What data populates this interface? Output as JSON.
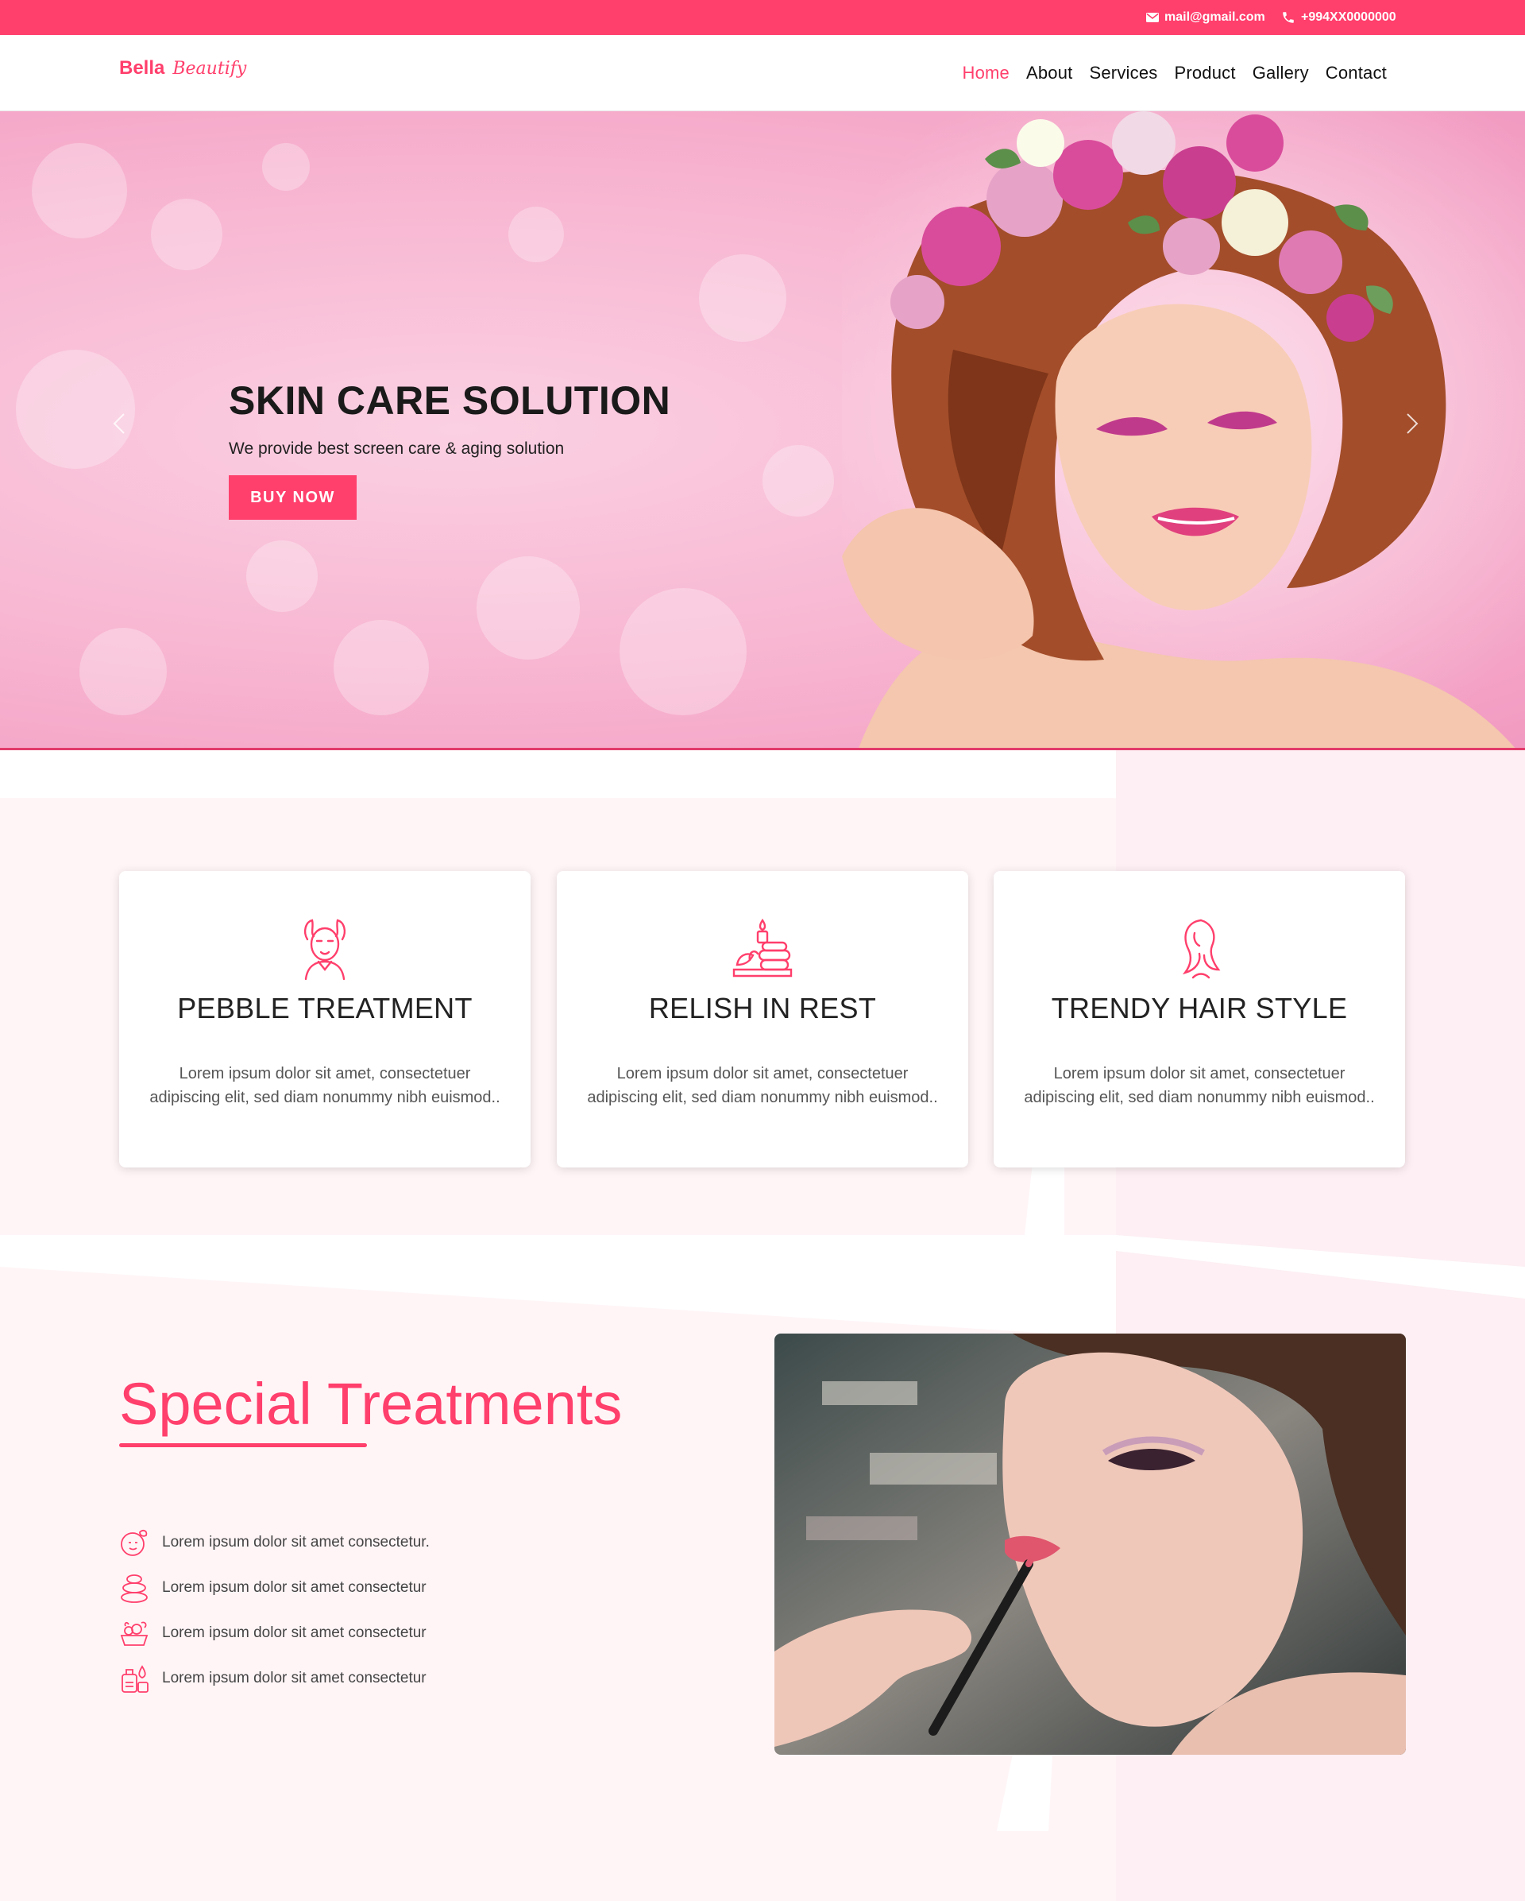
{
  "topbar": {
    "email": "mail@gmail.com",
    "phone": "+994XX0000000"
  },
  "nav": {
    "logo_bold": "Bella",
    "logo_script": "Beautify",
    "items": [
      {
        "label": "Home",
        "active": true
      },
      {
        "label": "About"
      },
      {
        "label": "Services"
      },
      {
        "label": "Product"
      },
      {
        "label": "Gallery"
      },
      {
        "label": "Contact"
      }
    ]
  },
  "hero": {
    "title": "SKIN CARE SOLUTION",
    "subtitle": "We provide best screen care & aging solution",
    "button": "BUY NOW"
  },
  "cards": [
    {
      "icon": "face-mask-icon",
      "title": "PEBBLE TREATMENT",
      "text": "Lorem ipsum dolor sit amet, consectetuer adipiscing elit, sed diam nonummy nibh euismod.."
    },
    {
      "icon": "spa-stones-candle-icon",
      "title": "RELISH IN REST",
      "text": "Lorem ipsum dolor sit amet, consectetuer adipiscing elit, sed diam nonummy nibh euismod.."
    },
    {
      "icon": "hair-style-icon",
      "title": "TRENDY HAIR STYLE",
      "text": "Lorem ipsum dolor sit amet, consectetuer adipiscing elit, sed diam nonummy nibh euismod.."
    }
  ],
  "special": {
    "title": "Special Treatments",
    "items": [
      {
        "icon": "face-leaf-icon",
        "text": "Lorem ipsum dolor sit amet consectetur."
      },
      {
        "icon": "stacked-stones-icon",
        "text": "Lorem ipsum dolor sit amet consectetur"
      },
      {
        "icon": "spa-basket-icon",
        "text": "Lorem ipsum dolor sit amet consectetur"
      },
      {
        "icon": "cosmetics-bottle-icon",
        "text": "Lorem ipsum dolor sit amet consectetur"
      }
    ]
  },
  "colors": {
    "accent": "#ff3f6c",
    "section_bg": "#fff5f7"
  }
}
